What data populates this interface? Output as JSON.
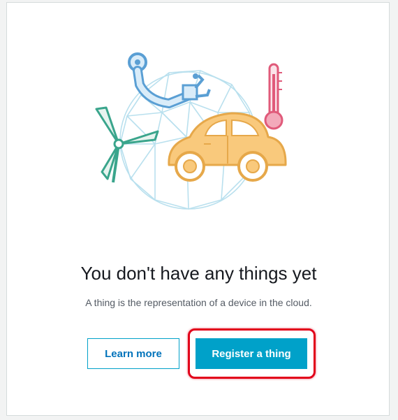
{
  "empty_state": {
    "title": "You don't have any things yet",
    "subtitle": "A thing is the representation of a device in the cloud."
  },
  "actions": {
    "learn_more_label": "Learn more",
    "register_label": "Register a thing"
  },
  "illustration": {
    "icons": [
      "cloud-network-icon",
      "robot-arm-icon",
      "wind-turbine-icon",
      "thermometer-icon",
      "car-icon"
    ]
  },
  "colors": {
    "primary": "#00a1c9",
    "link": "#0073bb",
    "highlight": "#e2001a",
    "car": "#f9c97c",
    "turbine": "#3aa58c",
    "thermometer": "#e05a7a",
    "robot_arm": "#5a9fd4",
    "network": "#b9e0ee"
  }
}
